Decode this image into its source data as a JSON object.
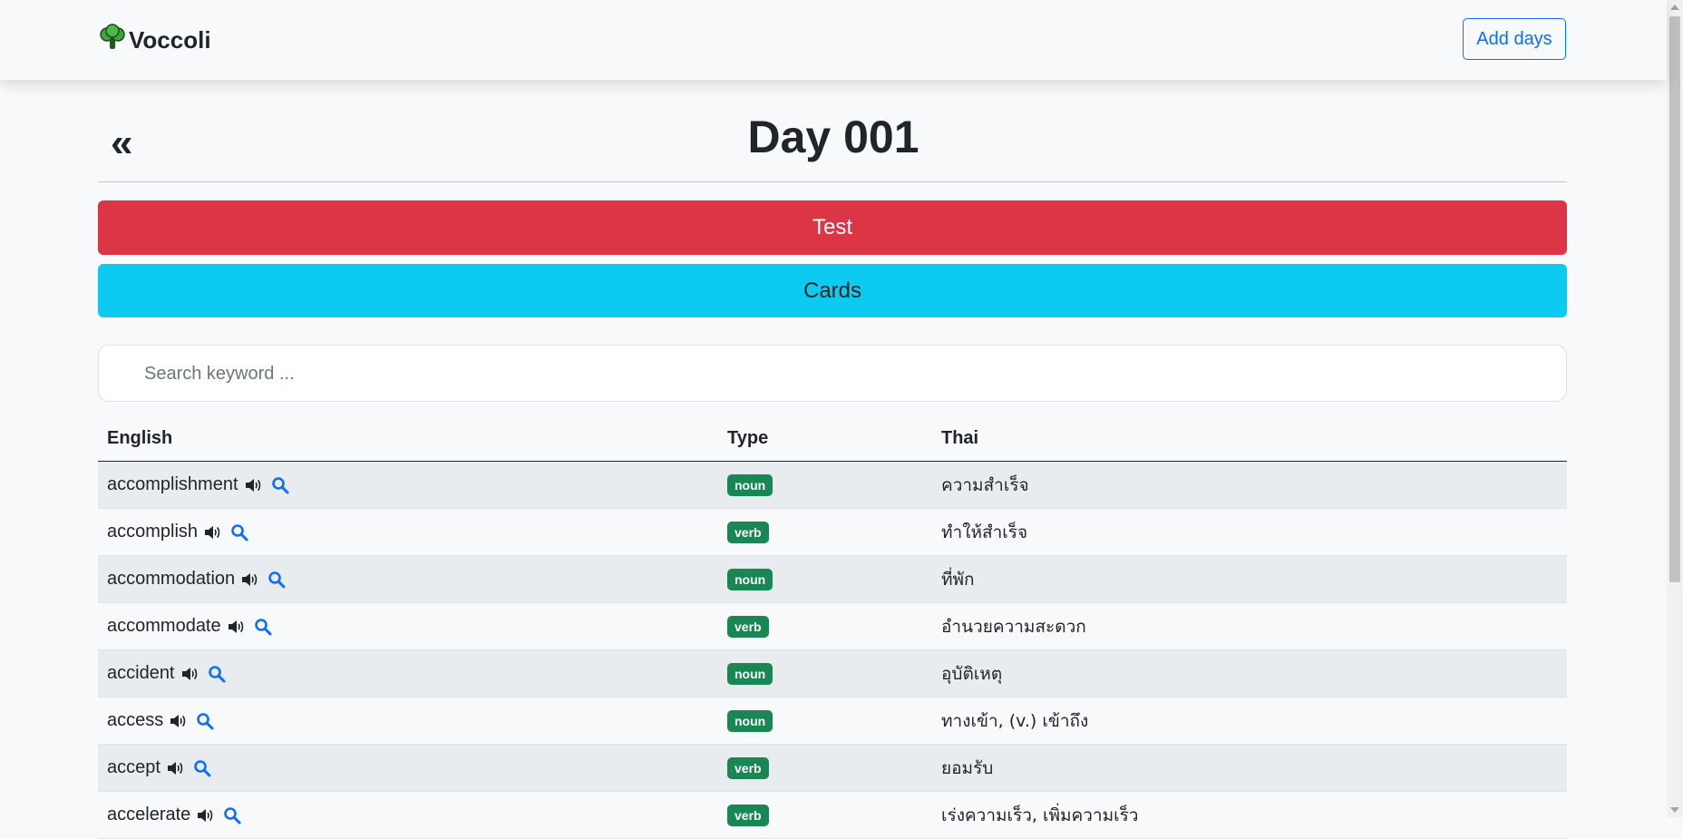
{
  "navbar": {
    "brand": "Voccoli",
    "brand_icon": "broccoli-icon",
    "add_days_label": "Add days"
  },
  "page": {
    "back_label": "«",
    "title": "Day 001"
  },
  "actions": {
    "test_label": "Test",
    "cards_label": "Cards"
  },
  "search": {
    "placeholder": "Search keyword ..."
  },
  "table": {
    "headers": {
      "english": "English",
      "type": "Type",
      "thai": "Thai"
    },
    "rows": [
      {
        "english": "accomplishment",
        "type": "noun",
        "thai": "ความสำเร็จ"
      },
      {
        "english": "accomplish",
        "type": "verb",
        "thai": "ทำให้สำเร็จ"
      },
      {
        "english": "accommodation",
        "type": "noun",
        "thai": "ที่พัก"
      },
      {
        "english": "accommodate",
        "type": "verb",
        "thai": "อำนวยความสะดวก"
      },
      {
        "english": "accident",
        "type": "noun",
        "thai": "อุบัติเหตุ"
      },
      {
        "english": "access",
        "type": "noun",
        "thai": "ทางเข้า, (v.) เข้าถึง"
      },
      {
        "english": "accept",
        "type": "verb",
        "thai": "ยอมรับ"
      },
      {
        "english": "accelerate",
        "type": "verb",
        "thai": "เร่งความเร็ว, เพิ่มความเร็ว"
      }
    ]
  },
  "colors": {
    "primary": "#0d6efd",
    "danger": "#dc3545",
    "info": "#0dcaf0",
    "success": "#198754"
  }
}
